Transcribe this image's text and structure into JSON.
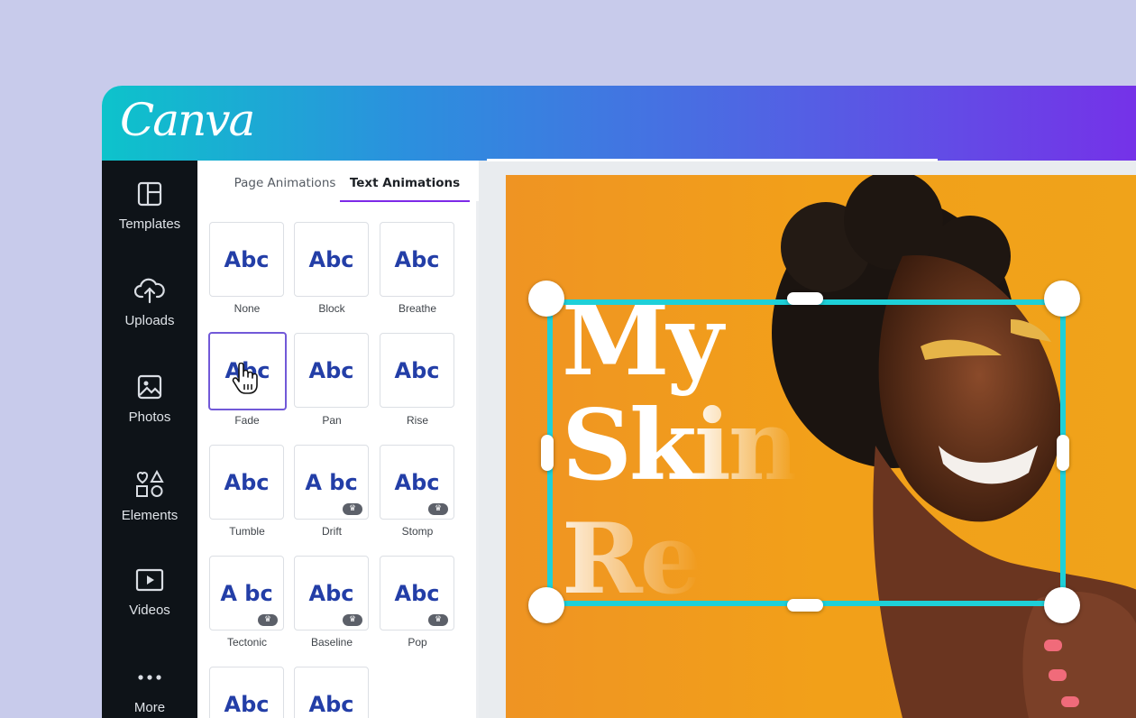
{
  "app": {
    "logo": "Canva"
  },
  "sidebar": {
    "items": [
      {
        "label": "Templates",
        "icon": "templates-icon"
      },
      {
        "label": "Uploads",
        "icon": "upload-icon"
      },
      {
        "label": "Photos",
        "icon": "image-icon"
      },
      {
        "label": "Elements",
        "icon": "shapes-icon"
      },
      {
        "label": "Videos",
        "icon": "video-icon"
      },
      {
        "label": "More",
        "icon": "more-dots-icon"
      }
    ]
  },
  "panel": {
    "tabs": [
      {
        "label": "Page Animations",
        "active": false
      },
      {
        "label": "Text Animations",
        "active": true
      }
    ],
    "animations": [
      {
        "preview": "Abc",
        "label": "None",
        "pro": false
      },
      {
        "preview": "Abc",
        "label": "Block",
        "pro": false
      },
      {
        "preview": "Abc",
        "label": "Breathe",
        "pro": false
      },
      {
        "preview": "Abc",
        "label": "Fade",
        "pro": false,
        "selected": true
      },
      {
        "preview": "Abc",
        "label": "Pan",
        "pro": false
      },
      {
        "preview": "Abc",
        "label": "Rise",
        "pro": false
      },
      {
        "preview": "Abc",
        "label": "Tumble",
        "pro": false
      },
      {
        "preview": "A bc",
        "label": "Drift",
        "pro": true
      },
      {
        "preview": "Abc",
        "label": "Stomp",
        "pro": true
      },
      {
        "preview": "A bc",
        "label": "Tectonic",
        "pro": true
      },
      {
        "preview": "Abc",
        "label": "Baseline",
        "pro": true
      },
      {
        "preview": "Abc",
        "label": "Pop",
        "pro": true
      },
      {
        "preview": "Abc",
        "label": "",
        "pro": false
      },
      {
        "preview": "Abc",
        "label": "",
        "pro": false
      }
    ]
  },
  "canvas": {
    "lines": [
      "My",
      "Skin",
      "Re"
    ],
    "background_color": "#f0a01c",
    "selection_color": "#1ed0d8"
  },
  "colors": {
    "accent": "#7d2ae8",
    "preview_text": "#233ea7",
    "sidebar_bg": "#0e1318"
  }
}
